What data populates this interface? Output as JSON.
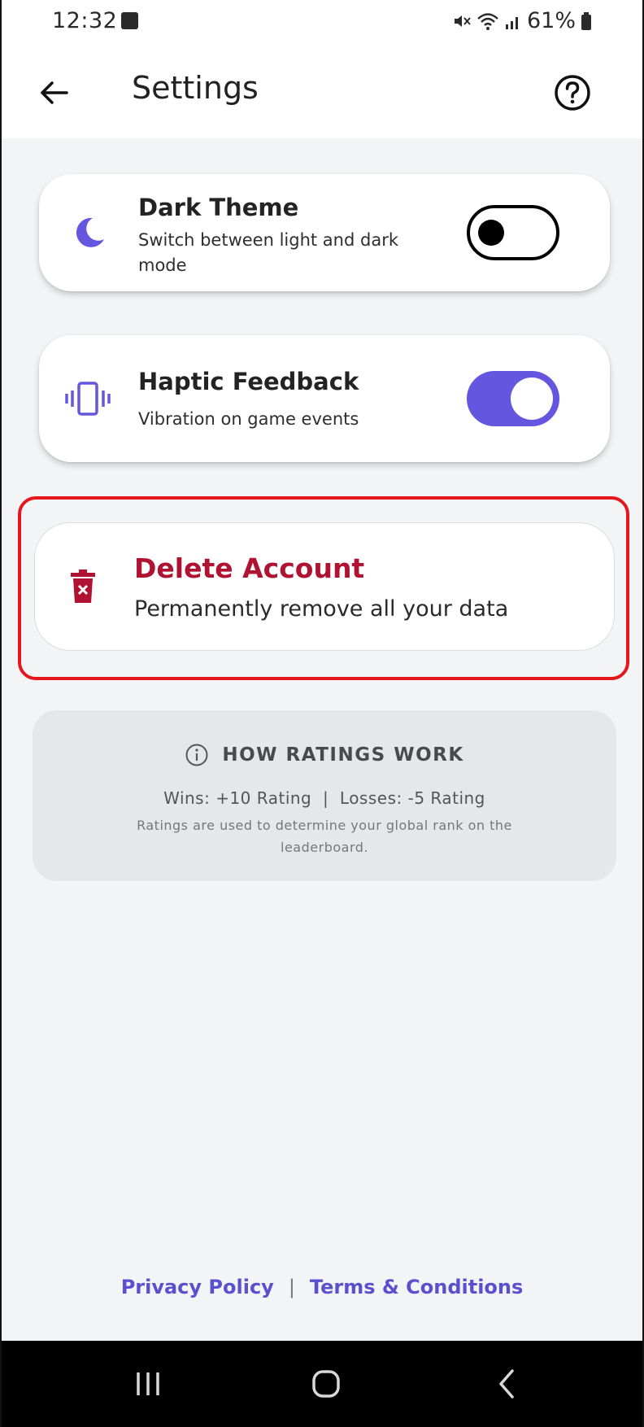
{
  "status_bar": {
    "time": "12:32",
    "battery": "61%"
  },
  "app_bar": {
    "title": "Settings"
  },
  "settings": {
    "dark_theme": {
      "title": "Dark Theme",
      "subtitle": "Switch between light and dark mode",
      "enabled": false
    },
    "haptic_feedback": {
      "title": "Haptic Feedback",
      "subtitle": "Vibration on game events",
      "enabled": true
    },
    "delete_account": {
      "title": "Delete Account",
      "subtitle": "Permanently remove all your data"
    }
  },
  "ratings_info": {
    "title": "HOW RATINGS WORK",
    "line1": "Wins: +10 Rating  |  Losses: -5 Rating",
    "line2": "Ratings are used to determine your global rank on the leaderboard."
  },
  "footer": {
    "privacy": "Privacy Policy",
    "separator": "|",
    "terms": "Terms & Conditions"
  },
  "colors": {
    "accent": "#6556e0",
    "danger": "#b01231",
    "highlight": "#e5161c",
    "link": "#5a4fcf"
  },
  "icons": {
    "back": "arrow-left-icon",
    "help": "help-circle-icon",
    "dark_theme": "moon-icon",
    "haptic": "vibration-icon",
    "delete": "trash-icon",
    "info": "info-icon",
    "nav_recents": "recents-icon",
    "nav_home": "home-icon",
    "nav_back": "nav-back-icon"
  }
}
